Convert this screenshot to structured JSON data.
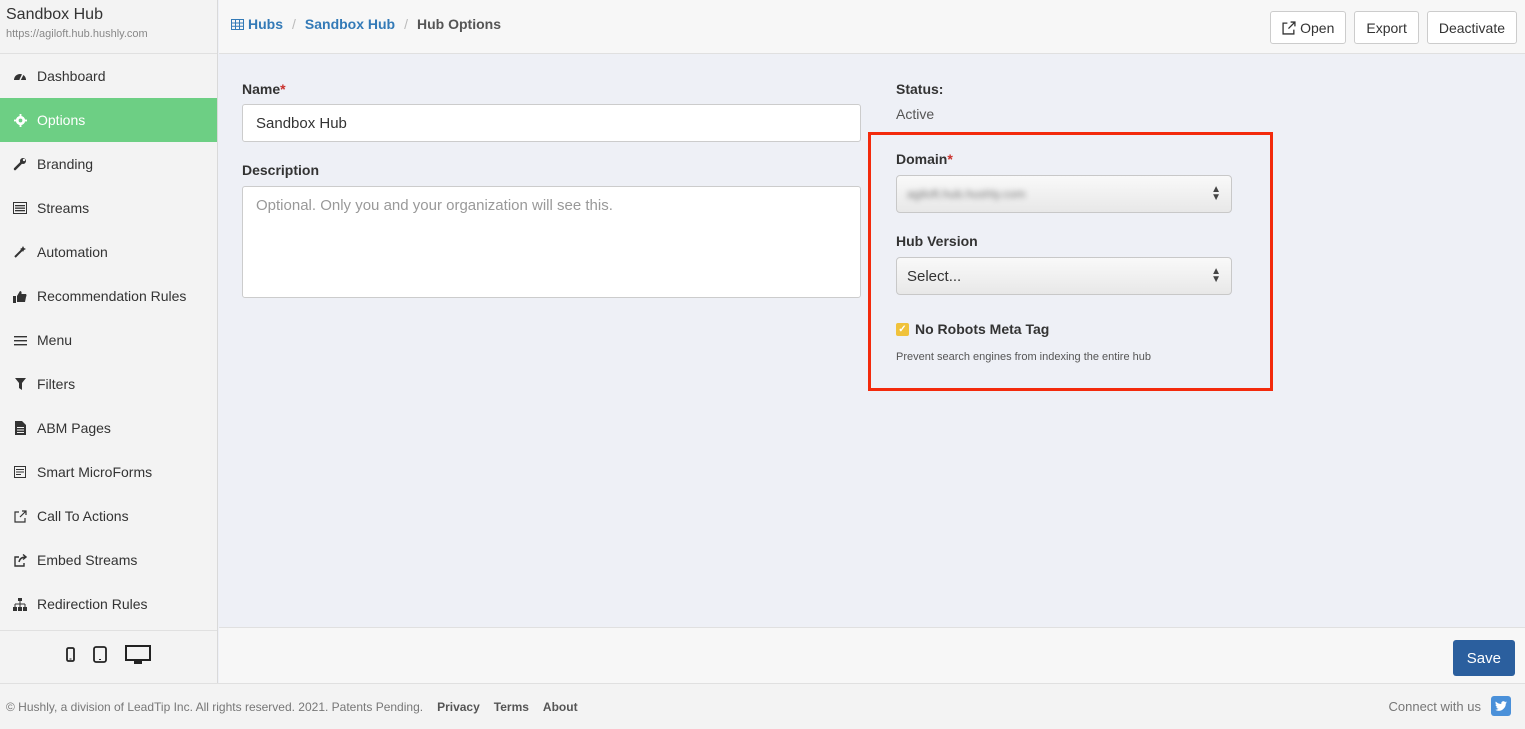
{
  "hub": {
    "title": "Sandbox Hub",
    "url": "https://agiloft.hub.hushly.com"
  },
  "sidebar": {
    "items": [
      {
        "label": "Dashboard",
        "icon": "dashboard-icon"
      },
      {
        "label": "Options",
        "icon": "gear-icon",
        "active": true
      },
      {
        "label": "Branding",
        "icon": "wrench-icon"
      },
      {
        "label": "Streams",
        "icon": "list-box-icon"
      },
      {
        "label": "Automation",
        "icon": "magic-wand-icon"
      },
      {
        "label": "Recommendation Rules",
        "icon": "thumbs-up-icon"
      },
      {
        "label": "Menu",
        "icon": "menu-lines-icon"
      },
      {
        "label": "Filters",
        "icon": "filter-icon"
      },
      {
        "label": "ABM Pages",
        "icon": "file-icon"
      },
      {
        "label": "Smart MicroForms",
        "icon": "form-icon"
      },
      {
        "label": "Call To Actions",
        "icon": "external-link-icon"
      },
      {
        "label": "Embed Streams",
        "icon": "share-box-icon"
      },
      {
        "label": "Redirection Rules",
        "icon": "sitemap-icon"
      }
    ],
    "devices": [
      "mobile-icon",
      "tablet-icon",
      "desktop-icon"
    ]
  },
  "breadcrumb": {
    "hubs": "Hubs",
    "hub": "Sandbox Hub",
    "current": "Hub Options"
  },
  "toolbar": {
    "open": "Open",
    "export": "Export",
    "deactivate": "Deactivate"
  },
  "form": {
    "name_label": "Name",
    "required_mark": "*",
    "name_value": "Sandbox Hub",
    "description_label": "Description",
    "description_placeholder": "Optional. Only you and your organization will see this.",
    "status_label": "Status:",
    "status_value": "Active",
    "domain_label": "Domain",
    "domain_value": "agiloft.hub.hushly.com",
    "hub_version_label": "Hub Version",
    "hub_version_value": "Select...",
    "no_robots_label": "No Robots Meta Tag",
    "no_robots_checked": true,
    "no_robots_help": "Prevent search engines from indexing the entire hub"
  },
  "save_label": "Save",
  "footer": {
    "copyright": "© Hushly, a division of LeadTip Inc. All rights reserved. 2021. Patents Pending.",
    "privacy": "Privacy",
    "terms": "Terms",
    "about": "About",
    "connect": "Connect with us"
  },
  "colors": {
    "active_nav": "#6dcf84",
    "link": "#337ab7",
    "save": "#2b5f9e",
    "highlight": "#f32a0c",
    "checkbox": "#f0c23b"
  }
}
